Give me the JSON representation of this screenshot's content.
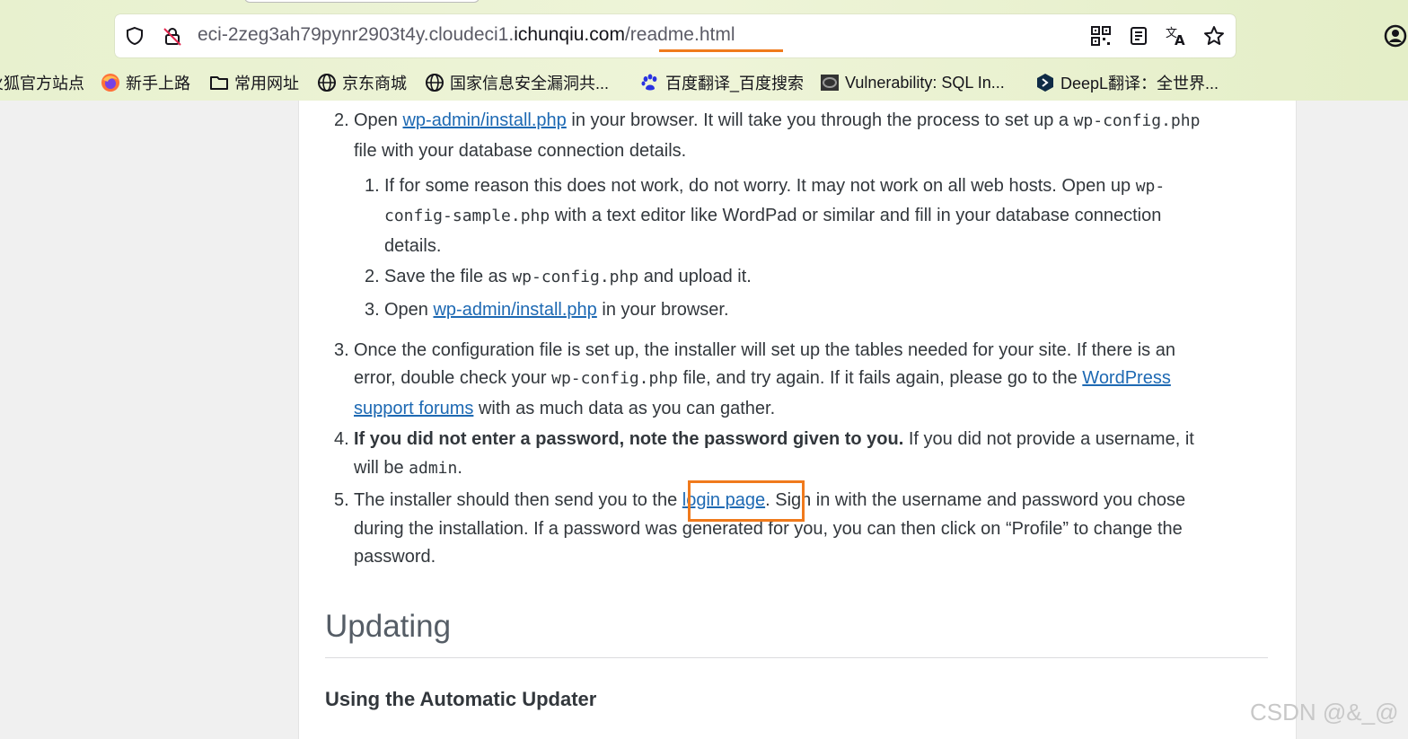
{
  "browser": {
    "url_host_prefix": "eci-2zeg3ah79pynr2903t4y.cloudeci1.",
    "url_host_domain": "ichunqiu.com",
    "url_slash": "/",
    "url_path": "readme.html",
    "bookmarks": [
      {
        "label": "火狐官方站点",
        "icon": "firefox-icon"
      },
      {
        "label": "新手上路",
        "icon": "firefox-icon"
      },
      {
        "label": "常用网址",
        "icon": "folder-icon"
      },
      {
        "label": "京东商城",
        "icon": "globe-icon"
      },
      {
        "label": "国家信息安全漏洞共...",
        "icon": "globe-icon"
      },
      {
        "label": "百度翻译_百度搜索",
        "icon": "baidu-paw-icon"
      },
      {
        "label": "Vulnerability: SQL In...",
        "icon": "dvwa-icon"
      },
      {
        "label": "DeepL翻译：全世界...",
        "icon": "deepl-icon"
      }
    ]
  },
  "article": {
    "step2": {
      "num": "2.",
      "open": "Open ",
      "link": "wp-admin/install.php",
      "rest": " in your browser. It will take you through the process to set up a ",
      "code": "wp-config.php",
      "line2": "file with your database connection details.",
      "sub": [
        {
          "num": "1.",
          "l1a": "If for some reason this does not work, do not worry. It may not work on all web hosts. Open up ",
          "l1code": "wp-",
          "l2code": "config-sample.php",
          "l2b": " with a text editor like WordPad or similar and fill in your database connection",
          "l3": "details."
        },
        {
          "num": "2.",
          "a": "Save the file as ",
          "code": "wp-config.php",
          "b": " and upload it."
        },
        {
          "num": "3.",
          "a": "Open ",
          "link": "wp-admin/install.php",
          "b": " in your browser."
        }
      ]
    },
    "step3": {
      "num": "3.",
      "l1": "Once the configuration file is set up, the installer will set up the tables needed for your site. If there is an",
      "l2a": "error, double check your ",
      "l2code": "wp-config.php",
      "l2b": " file, and try again. If it fails again, please go to the ",
      "l2link": "WordPress",
      "l3link": "support forums",
      "l3b": " with as much data as you can gather."
    },
    "step4": {
      "num": "4.",
      "bold": "If you did not enter a password, note the password given to you.",
      "rest": " If you did not provide a username, it",
      "l2a": "will be ",
      "l2code": "admin",
      "l2b": "."
    },
    "step5": {
      "num": "5.",
      "a": "The installer should then send you to the ",
      "link": "login page",
      "b": ". Sign in with the username and password you chose",
      "l2": "during the installation. If a password was generated for you, you can then click on “Profile” to change the",
      "l3": "password."
    },
    "heading_updating": "Updating",
    "heading_auto": "Using the Automatic Updater"
  },
  "watermark": "CSDN @&_@",
  "colors": {
    "link": "#1d69b3",
    "highlight": "#f07a1c",
    "text": "#32373c"
  }
}
